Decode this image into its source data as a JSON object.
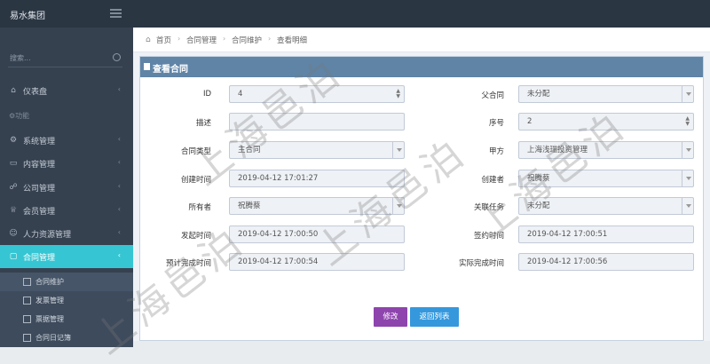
{
  "app": {
    "title": "易水集团"
  },
  "sidebar": {
    "search_placeholder": "搜索...",
    "items": [
      {
        "label": "仪表盘",
        "icon": "home-icon"
      },
      {
        "label": "功能",
        "section": true
      },
      {
        "label": "系统管理",
        "icon": "settings-icon"
      },
      {
        "label": "内容管理",
        "icon": "content-icon"
      },
      {
        "label": "公司管理",
        "icon": "org-icon"
      },
      {
        "label": "会员管理",
        "icon": "trophy-icon"
      },
      {
        "label": "人力资源管理",
        "icon": "people-icon"
      },
      {
        "label": "合同管理",
        "icon": "contract-icon",
        "active": true
      }
    ],
    "sub_items": [
      {
        "label": "合同维护"
      },
      {
        "label": "发票管理"
      },
      {
        "label": "票据管理"
      },
      {
        "label": "合同日记簿"
      }
    ]
  },
  "breadcrumb": [
    "首页",
    "合同管理",
    "合同维护",
    "查看明细"
  ],
  "panel": {
    "title": "查看合同"
  },
  "form": {
    "left": [
      {
        "label": "ID",
        "value": "4",
        "kind": "spin"
      },
      {
        "label": "描述",
        "value": "",
        "kind": "text"
      },
      {
        "label": "合同类型",
        "value": "主合同",
        "kind": "select"
      },
      {
        "label": "创建时间",
        "value": "2019-04-12 17:01:27",
        "kind": "text"
      },
      {
        "label": "所有者",
        "value": "祝腾蔡",
        "kind": "select"
      },
      {
        "label": "发起时间",
        "value": "2019-04-12 17:00:50",
        "kind": "text"
      },
      {
        "label": "预计完成时间",
        "value": "2019-04-12 17:00:54",
        "kind": "text"
      }
    ],
    "right": [
      {
        "label": "父合同",
        "value": "未分配",
        "kind": "select"
      },
      {
        "label": "序号",
        "value": "2",
        "kind": "spin"
      },
      {
        "label": "甲方",
        "value": "上海浅瑞投资管理",
        "kind": "select"
      },
      {
        "label": "创建者",
        "value": "祝腾蔡",
        "kind": "select"
      },
      {
        "label": "关联任务",
        "value": "未分配",
        "kind": "select"
      },
      {
        "label": "签约时间",
        "value": "2019-04-12 17:00:51",
        "kind": "text"
      },
      {
        "label": "实际完成时间",
        "value": "2019-04-12 17:00:56",
        "kind": "text"
      }
    ]
  },
  "buttons": {
    "edit": "修改",
    "back": "返回列表"
  },
  "colors": {
    "sidebar": "#364150",
    "topbar": "#2b3643",
    "active": "#36c6d3",
    "panel_head": "#5f84a6",
    "edit_button": "#8e44ad",
    "back_button": "#3598dc"
  },
  "watermark": "上海邑泊"
}
